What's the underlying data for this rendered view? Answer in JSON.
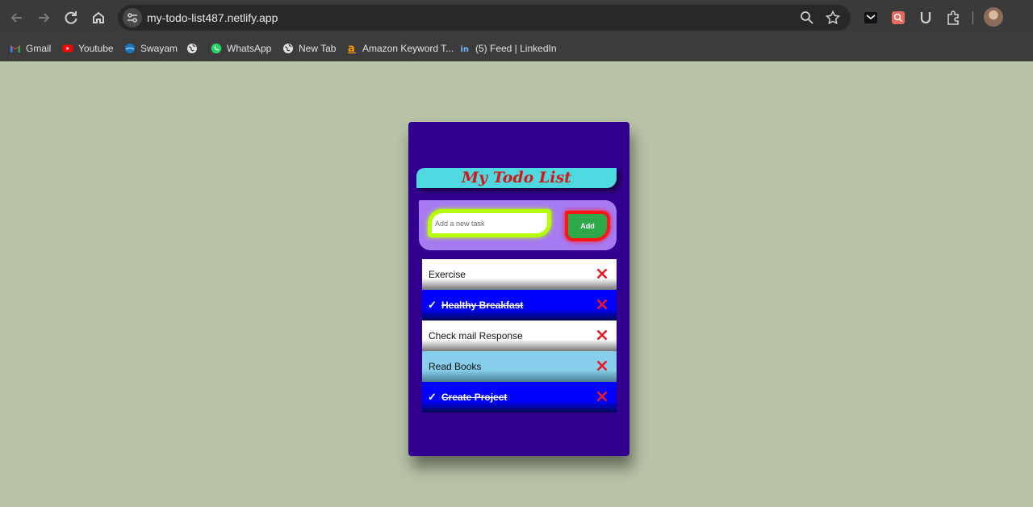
{
  "browser": {
    "url": "my-todo-list487.netlify.app",
    "bookmarks": [
      {
        "label": "Gmail",
        "icon": "gmail-icon"
      },
      {
        "label": "Youtube",
        "icon": "youtube-icon"
      },
      {
        "label": "Swayam",
        "icon": "swayam-icon"
      },
      {
        "label": "",
        "icon": "globe-icon"
      },
      {
        "label": "WhatsApp",
        "icon": "whatsapp-icon"
      },
      {
        "label": "New Tab",
        "icon": "globe-icon"
      },
      {
        "label": "Amazon Keyword T...",
        "icon": "amazon-icon"
      },
      {
        "label": "(5) Feed | LinkedIn",
        "icon": "linkedin-icon"
      }
    ]
  },
  "app": {
    "title": "My Todo List",
    "input": {
      "placeholder": "Add a new task",
      "value": ""
    },
    "add_label": "Add",
    "tasks": [
      {
        "text": "Exercise",
        "completed": false,
        "style": "white"
      },
      {
        "text": "Healthy Breakfast",
        "completed": true,
        "style": "blue"
      },
      {
        "text": "Check mail Response",
        "completed": false,
        "style": "white"
      },
      {
        "text": "Read Books",
        "completed": false,
        "style": "light"
      },
      {
        "text": "Create Project",
        "completed": true,
        "style": "blue"
      }
    ],
    "check_glyph": "✓"
  },
  "colors": {
    "page_bg": "#b8c3a6",
    "card_bg": "#32008f",
    "title_bg": "#4fd8e0",
    "title_text": "#d41818",
    "panel_bg": "#a77bf2",
    "input_border": "#b6ff00",
    "add_bg": "#2ea84a",
    "add_border": "#ff1515",
    "done_bg": "#0000ff",
    "delete": "#e8182a"
  }
}
